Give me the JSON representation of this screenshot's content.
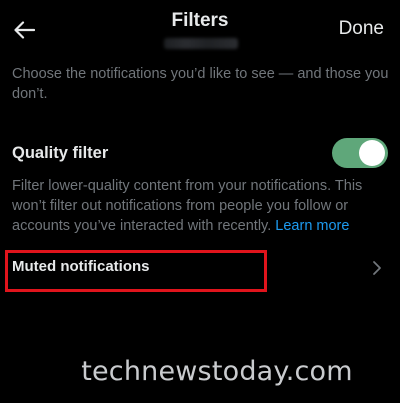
{
  "header": {
    "title": "Filters",
    "done_label": "Done",
    "back_icon": "arrow-left-icon"
  },
  "intro_text": "Choose the notifications you’d like to see — and those you don’t.",
  "quality_filter": {
    "label": "Quality filter",
    "enabled": true,
    "toggle_color": "#5fa77a",
    "description": "Filter lower-quality content from your notifications. This won’t filter out notifications from people you follow or accounts you’ve interacted with recently.",
    "learn_more": "Learn more",
    "link_color": "#1d9bf0"
  },
  "muted_notifications": {
    "label": "Muted notifications",
    "chevron_icon": "chevron-right-icon",
    "highlight_color": "#e0141c"
  },
  "watermark": "technewstoday.com",
  "colors": {
    "background": "#000000",
    "primary_text": "#e7e9ea",
    "secondary_text": "#71767b"
  }
}
